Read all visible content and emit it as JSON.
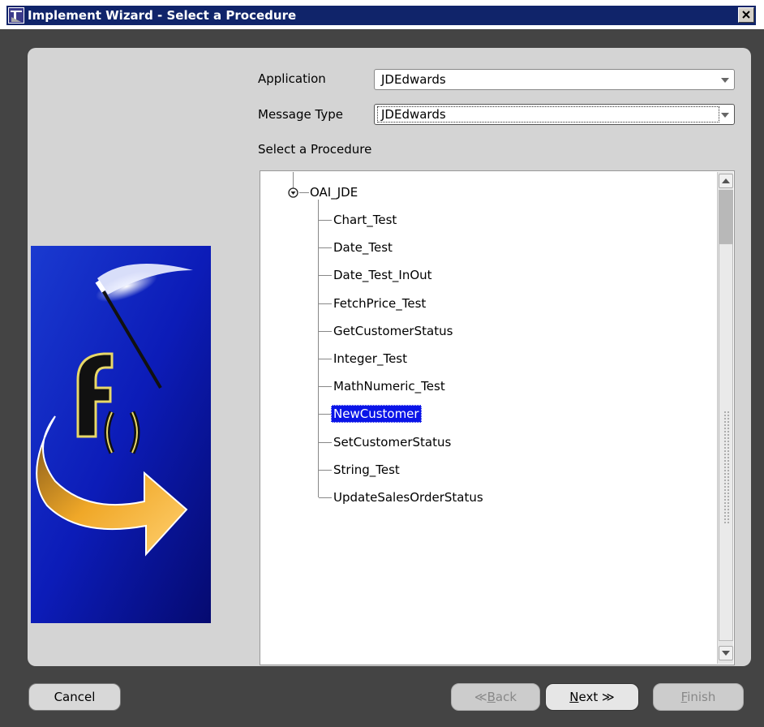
{
  "window": {
    "title": "Implement Wizard - Select a Procedure",
    "close_glyph": "✕"
  },
  "form": {
    "application_label": "Application",
    "application_value": "JDEdwards",
    "message_type_label": "Message Type",
    "message_type_value": "JDEdwards",
    "select_procedure_label": "Select a Procedure"
  },
  "tree": {
    "root": "OAI_JDE",
    "items": [
      "Chart_Test",
      "Date_Test",
      "Date_Test_InOut",
      "FetchPrice_Test",
      "GetCustomerStatus",
      "Integer_Test",
      "MathNumeric_Test",
      "NewCustomer",
      "SetCustomerStatus",
      "String_Test",
      "UpdateSalesOrderStatus"
    ],
    "selected": "NewCustomer"
  },
  "buttons": {
    "cancel": "Cancel",
    "back_arrow": "≪",
    "back_mnemonic": "B",
    "back_rest": "ack",
    "next_mnemonic": "N",
    "next_rest": "ext",
    "next_arrow": "≫",
    "finish_mnemonic": "F",
    "finish_rest": "inish"
  },
  "colors": {
    "title_bar": "#10246a",
    "selection": "#0a14e8",
    "panel": "#d4d4d4",
    "image_background": "#0c1cb8"
  }
}
